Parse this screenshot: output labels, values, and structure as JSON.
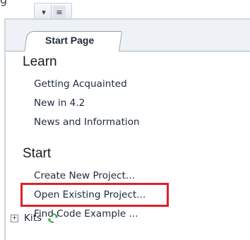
{
  "top_text": "g",
  "toolbar": {
    "pin_icon": "dropdown-pin-icon",
    "menu_icon": "toolbar-menu-icon",
    "pin_glyph": "▾",
    "menu_glyph": "≡"
  },
  "tabs": [
    {
      "label": "Start Page",
      "active": true
    }
  ],
  "sections": {
    "learn": {
      "heading": "Learn",
      "links": [
        "Getting Acquainted",
        "New in 4.2",
        "News and Information"
      ]
    },
    "start": {
      "heading": "Start",
      "links": [
        "Create New Project...",
        "Open Existing Project...",
        "Find Code Example ..."
      ]
    }
  },
  "tree": {
    "expander_glyph": "+",
    "kits_label": "Kits",
    "refresh_icon": "refresh-icon"
  },
  "colors": {
    "highlight": "#e0202a",
    "refresh": "#3aa63a"
  }
}
